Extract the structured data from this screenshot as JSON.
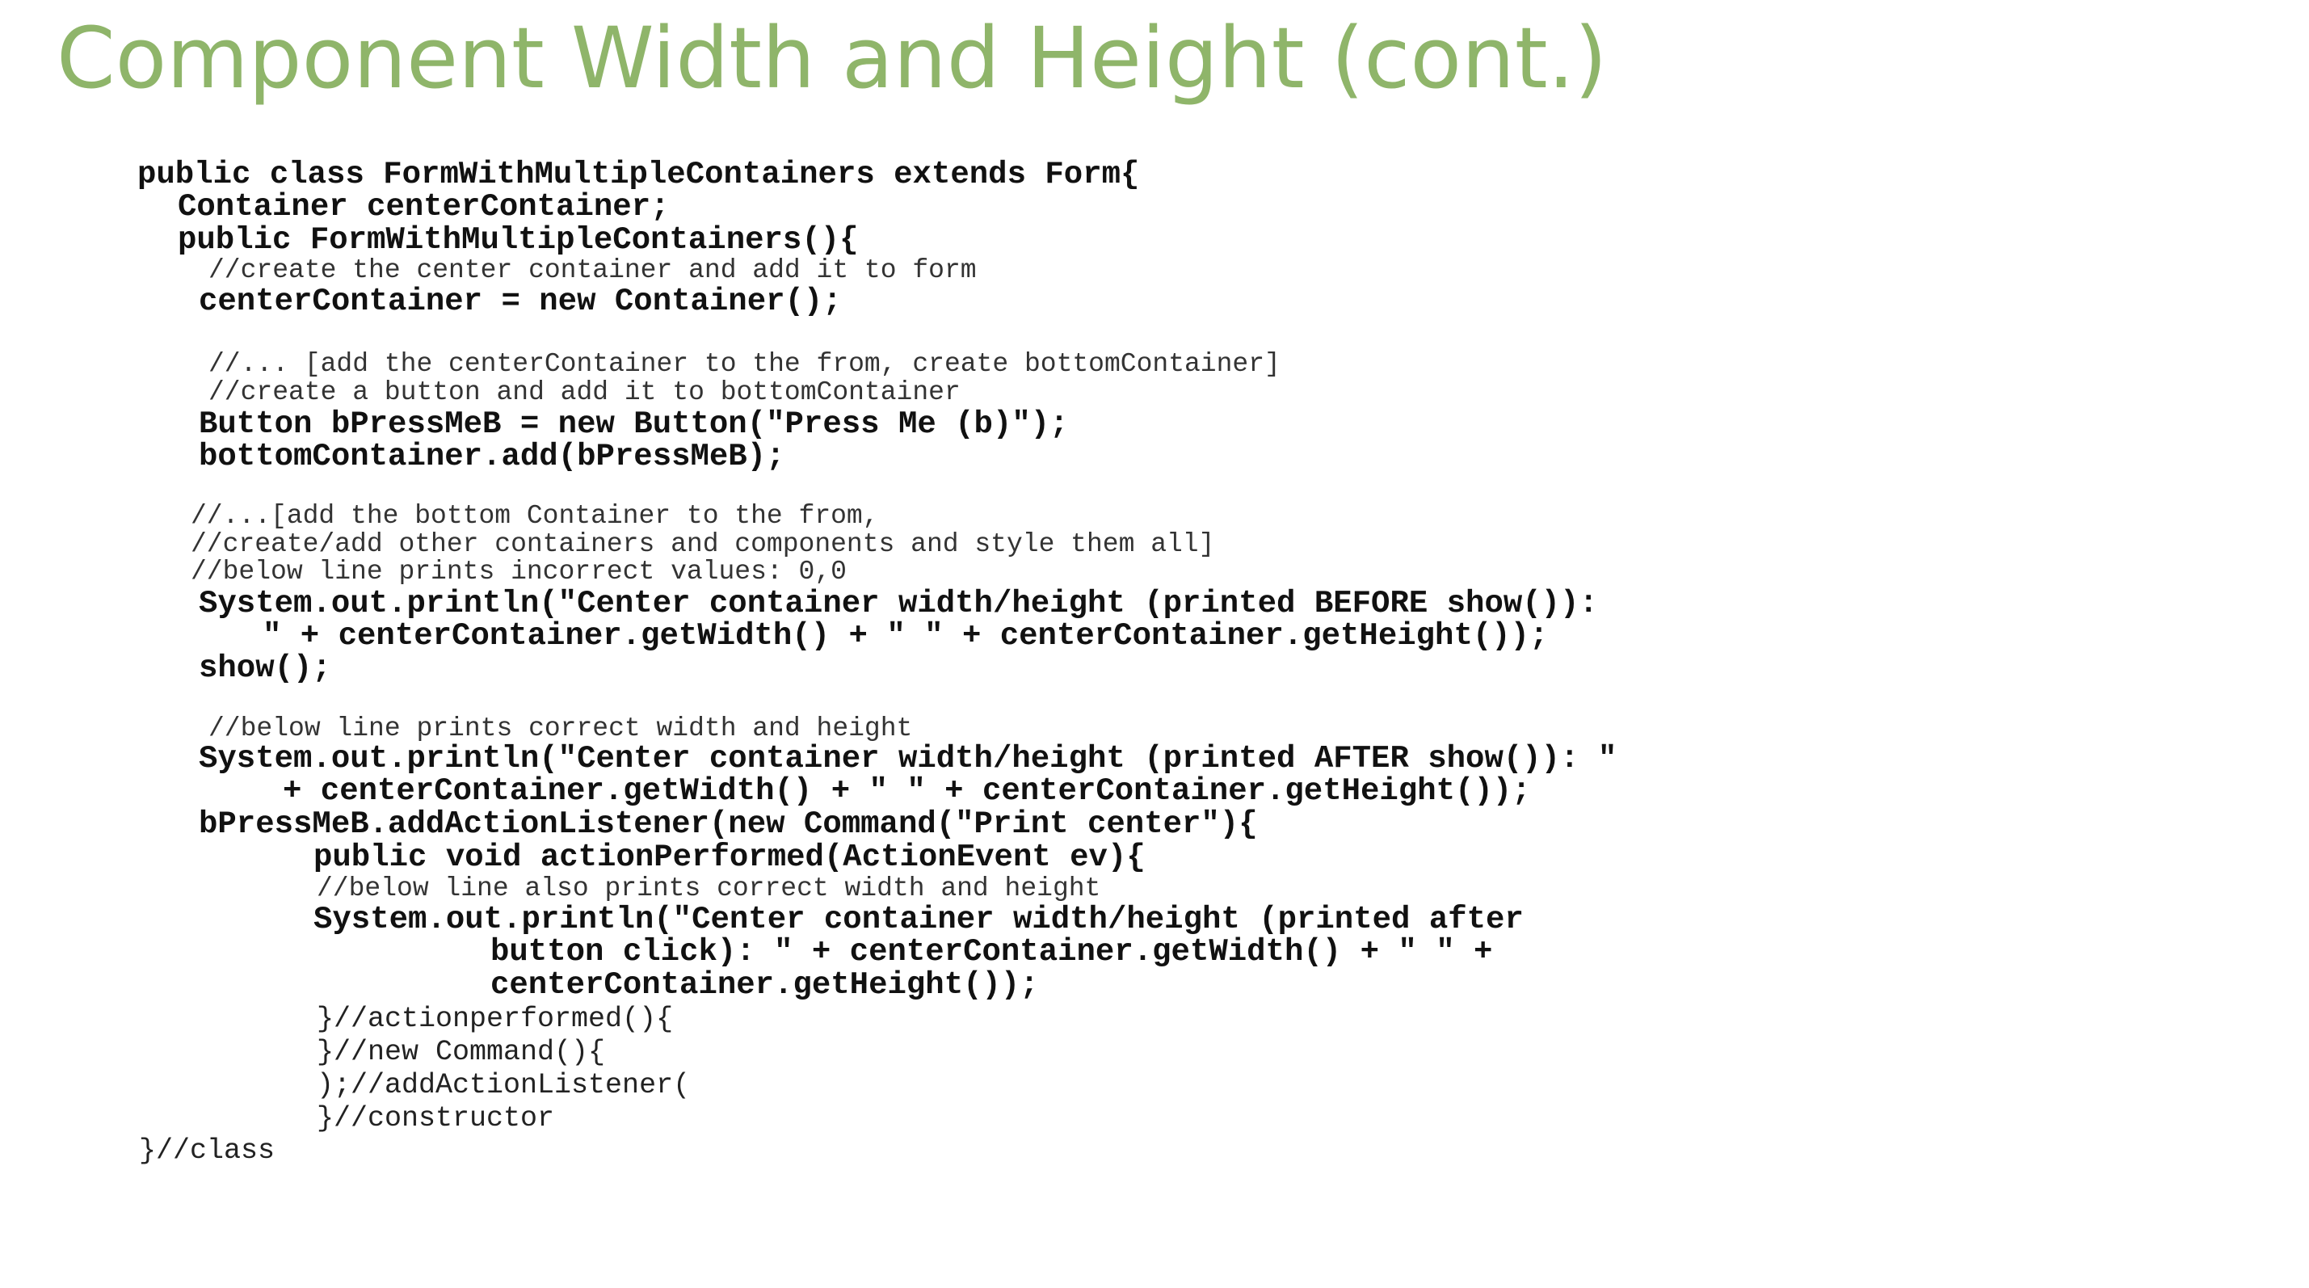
{
  "slide": {
    "title": "Component Width and Height (cont.)",
    "title_color": "#8fb56a"
  },
  "code": {
    "lines": [
      "public class FormWithMultipleContainers extends Form{",
      "Container centerContainer;",
      "public FormWithMultipleContainers(){",
      "//create the center container and add it to form",
      "centerContainer = new Container();",
      "//... [add the centerContainer to the from, create bottomContainer]",
      "//create a button and add it to bottomContainer",
      "Button bPressMeB = new Button(\"Press Me (b)\");",
      "bottomContainer.add(bPressMeB);",
      "//...[add the bottom Container to the from,",
      "//create/add other containers and components and style them all]",
      "//below line prints incorrect values: 0,0",
      "System.out.println(\"Center container width/height (printed BEFORE show()):",
      "\" + centerContainer.getWidth() + \" \" + centerContainer.getHeight());",
      "show();",
      "//below line prints correct width and height",
      "System.out.println(\"Center container width/height (printed AFTER show()): \"",
      "+ centerContainer.getWidth() + \" \" + centerContainer.getHeight());",
      "bPressMeB.addActionListener(new Command(\"Print center\"){",
      "public void actionPerformed(ActionEvent ev){",
      "//below line also prints correct width and height",
      "System.out.println(\"Center container width/height (printed after",
      "button click): \" + centerContainer.getWidth() + \" \" +",
      "centerContainer.getHeight());",
      "}//actionperformed(){",
      "}//new Command(){",
      ");//addActionListener(",
      "}//constructor",
      "}//class"
    ]
  }
}
